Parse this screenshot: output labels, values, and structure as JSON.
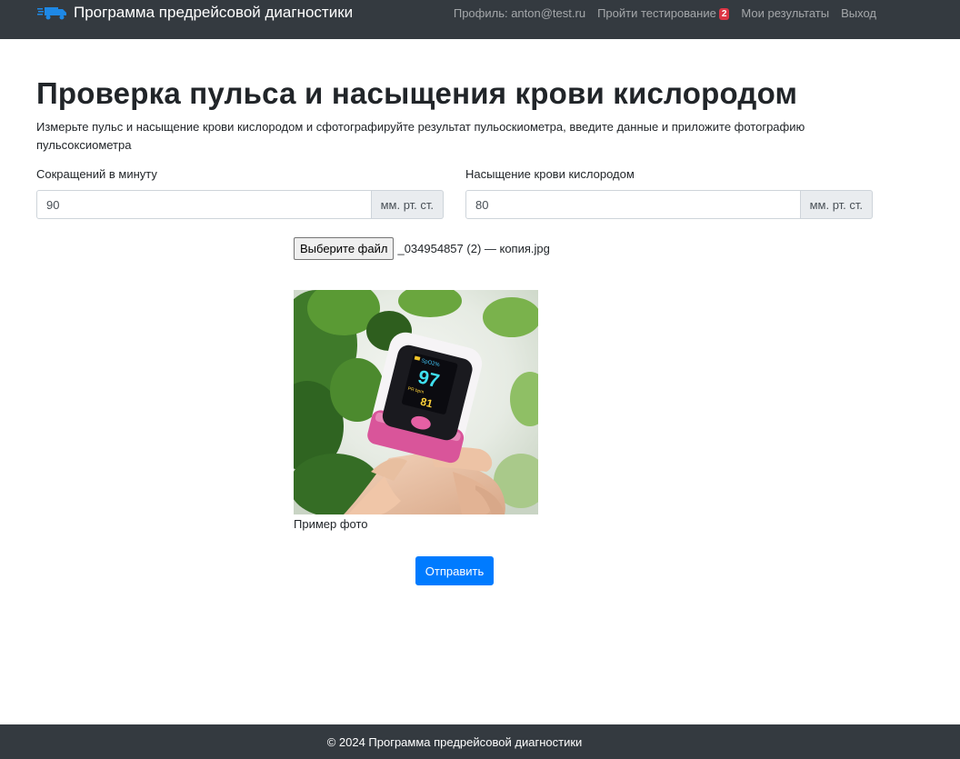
{
  "navbar": {
    "brand": "Программа предрейсовой диагностики",
    "brand_icon": "truck-icon",
    "links": [
      {
        "label": "Профиль: anton@test.ru"
      },
      {
        "label": "Пройти тестирование",
        "badge": "2"
      },
      {
        "label": "Мои результаты"
      },
      {
        "label": "Выход"
      }
    ]
  },
  "page": {
    "title": "Проверка пульса и насыщения крови кислородом",
    "description": "Измерьте пульс и насыщение крови кислородом и сфотографируйте результат пульоскиометра, введите данные и приложите фотографию пульсоксиометра"
  },
  "form": {
    "pulse": {
      "label": "Сокращений в минуту",
      "value": "90",
      "unit": "мм. рт. ст."
    },
    "oxygen": {
      "label": "Насыщение крови кислородом",
      "value": "80",
      "unit": "мм. рт. ст."
    },
    "file": {
      "button": "Выберите файл",
      "name": "_034954857 (2) — копия.jpg"
    },
    "photo": {
      "caption": "Пример фото",
      "screen_spo2": "SpO2%",
      "screen_spo2_value": "97",
      "screen_pr": "PR bpm",
      "screen_pr_value": "81"
    },
    "submit": "Отправить"
  },
  "footer": {
    "text": "© 2024 Программа предрейсовой диагностики"
  },
  "colors": {
    "navbar": "#343a40",
    "primary": "#007bff",
    "badge": "#dc3545"
  }
}
